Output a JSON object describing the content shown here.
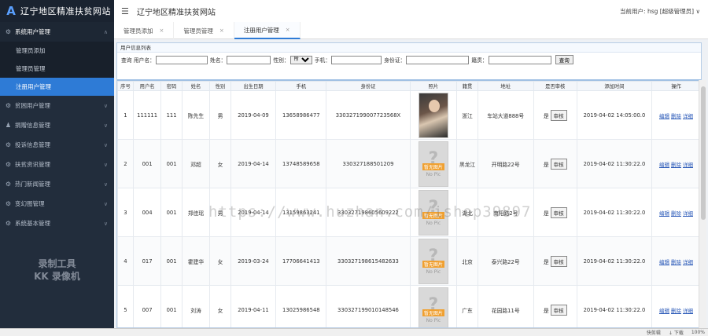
{
  "logo": {
    "text": "辽宁地区精准扶贫网站",
    "mark": "A"
  },
  "sidebar": {
    "groups": [
      {
        "label": "系统用户管理",
        "icon": "gear-icon",
        "glyph": "⚙",
        "open": true,
        "items": [
          {
            "label": "管理员添加",
            "active": false
          },
          {
            "label": "管理员管理",
            "active": false
          },
          {
            "label": "注册用户管理",
            "active": true
          }
        ]
      },
      {
        "label": "贫困用户管理",
        "icon": "gear-icon",
        "glyph": "⚙",
        "open": false
      },
      {
        "label": "捐赠信息管理",
        "icon": "user-icon",
        "glyph": "♟",
        "open": false
      },
      {
        "label": "投诉信息管理",
        "icon": "gear-icon",
        "glyph": "⚙",
        "open": false
      },
      {
        "label": "扶贫资讯管理",
        "icon": "gear-icon",
        "glyph": "⚙",
        "open": false
      },
      {
        "label": "热门新闻管理",
        "icon": "gear-icon",
        "glyph": "⚙",
        "open": false
      },
      {
        "label": "变幻图管理",
        "icon": "gear-icon",
        "glyph": "⚙",
        "open": false
      },
      {
        "label": "系统基本管理",
        "icon": "gear-icon",
        "glyph": "⚙",
        "open": false
      }
    ],
    "watermark_line1": "录制工具",
    "watermark_line2": "KK 录像机"
  },
  "header": {
    "menu_glyph": "☰",
    "title": "辽宁地区精准扶贫网站",
    "user": "当前用户: hsg [超级管理员]"
  },
  "tabs": [
    {
      "label": "管理员添加",
      "active": false
    },
    {
      "label": "管理员管理",
      "active": false
    },
    {
      "label": "注册用户管理",
      "active": true
    }
  ],
  "panel": {
    "title": "用户信息列表",
    "search": {
      "query_label": "查询 用户名：",
      "name_label": "姓名：",
      "gender_label": "性别：",
      "gender_selected": "所有",
      "phone_label": "手机：",
      "idcard_label": "身份证：",
      "origin_label": "籍贯：",
      "button": "查询"
    }
  },
  "table": {
    "headers": [
      "序号",
      "用户名",
      "密码",
      "姓名",
      "性别",
      "出生日期",
      "手机",
      "身份证",
      "照片",
      "籍贯",
      "地址",
      "是否审核",
      "添加时间",
      "操作"
    ],
    "rows": [
      {
        "no": "1",
        "user": "111111",
        "pwd": "111",
        "name": "陈先生",
        "gender": "男",
        "birth": "2019-04-09",
        "phone": "13658986477",
        "id": "330327199007723568X",
        "photo": "person",
        "origin": "浙江",
        "addr": "车站大道888号",
        "audited": "是",
        "time": "2019-04-02 14:05:00.0"
      },
      {
        "no": "2",
        "user": "001",
        "pwd": "001",
        "name": "邓超",
        "gender": "女",
        "birth": "2019-04-14",
        "phone": "13748589658",
        "id": "330327188501209",
        "photo": "nopic",
        "origin": "黑龙江",
        "addr": "开明路22号",
        "audited": "是",
        "time": "2019-04-02 11:30:22.0"
      },
      {
        "no": "3",
        "user": "004",
        "pwd": "001",
        "name": "郑佳瑶",
        "gender": "男",
        "birth": "2019-04-14",
        "phone": "13159863241",
        "id": "330327198605609222",
        "photo": "nopic",
        "origin": "湖北",
        "addr": "南阳路2号",
        "audited": "是",
        "time": "2019-04-02 11:30:22.0"
      },
      {
        "no": "4",
        "user": "017",
        "pwd": "001",
        "name": "霍建华",
        "gender": "女",
        "birth": "2019-03-24",
        "phone": "17706641413",
        "id": "330327198615482633",
        "photo": "nopic",
        "origin": "北京",
        "addr": "泰兴路22号",
        "audited": "是",
        "time": "2019-04-02 11:30:22.0"
      },
      {
        "no": "5",
        "user": "007",
        "pwd": "001",
        "name": "刘涛",
        "gender": "女",
        "birth": "2019-04-11",
        "phone": "13025986548",
        "id": "330327199010148546",
        "photo": "nopic",
        "origin": "广东",
        "addr": "花园路11号",
        "audited": "是",
        "time": "2019-04-02 11:30:22.0"
      }
    ],
    "audit_button": "审核",
    "ops": [
      "编辑",
      "删除",
      "详细"
    ],
    "nopic_banner": "暂无图片",
    "nopic_text": "No Pic"
  },
  "watermark": "https://www.huzhan.com/ishop39897",
  "statusbar": [
    "快剪辑",
    "↓ 下载",
    "100%"
  ]
}
